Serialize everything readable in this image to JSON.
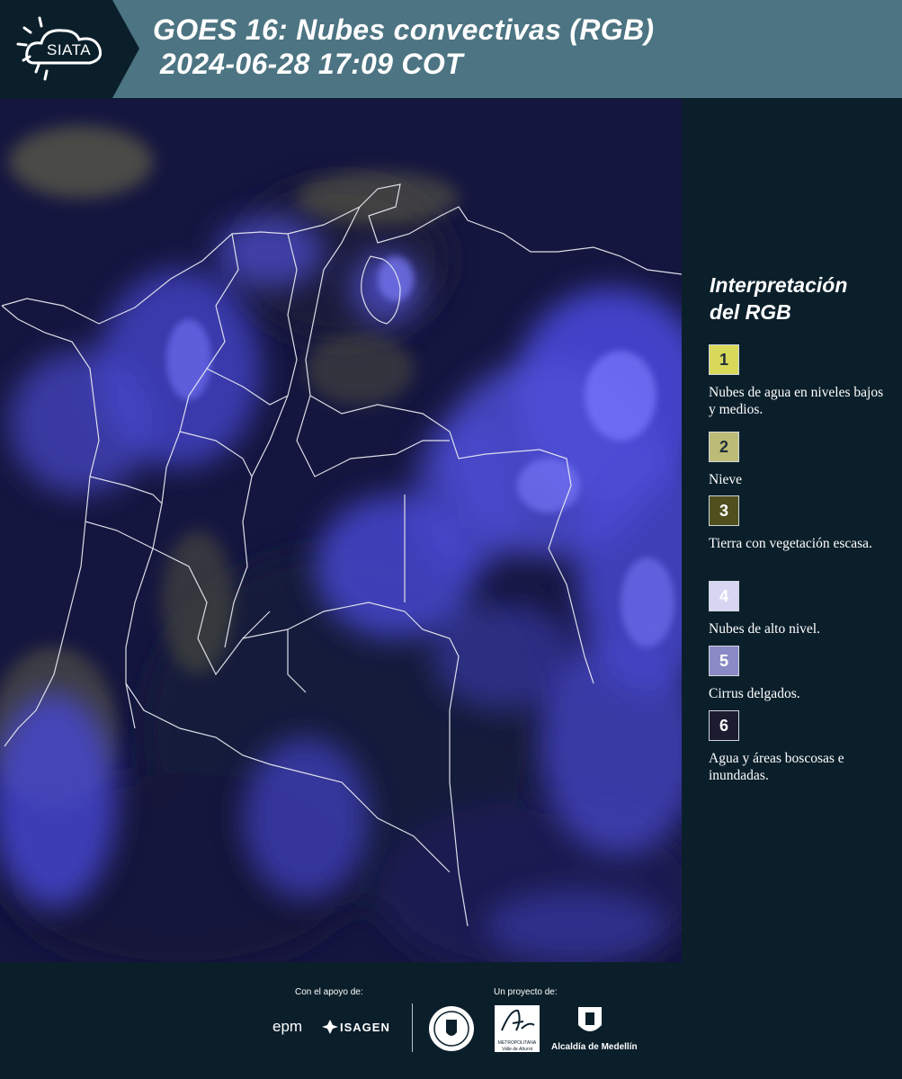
{
  "header": {
    "logo_text": "SIATA",
    "title_line1": "GOES 16: Nubes convectivas (RGB)",
    "title_line2": "2024-06-28 17:09 COT"
  },
  "legend": {
    "title_line1": "Interpretación",
    "title_line2": "del RGB",
    "items": [
      {
        "number": "1",
        "color": "#d8d85a",
        "text": "Nubes de agua en niveles bajos y medios."
      },
      {
        "number": "2",
        "color": "#bcbc76",
        "text": "Nieve"
      },
      {
        "number": "3",
        "color": "#50501e",
        "text": "Tierra con vegetación escasa."
      },
      {
        "number": "4",
        "color": "#d6d6f2",
        "text": "Nubes de alto nivel."
      },
      {
        "number": "5",
        "color": "#8a8ac6",
        "text": "Cirrus delgados."
      },
      {
        "number": "6",
        "color": "#1c1c30",
        "text": "Agua y áreas boscosas e inundadas."
      }
    ]
  },
  "footer": {
    "support_label": "Con el apoyo de:",
    "project_label": "Un proyecto de:",
    "epm": "epm",
    "isagen": "ISAGEN",
    "metropolitana_line1": "METROPOLITANA",
    "metropolitana_line2": "Valle de Aburrá",
    "alcaldia": "Alcaldía de Medellín"
  }
}
